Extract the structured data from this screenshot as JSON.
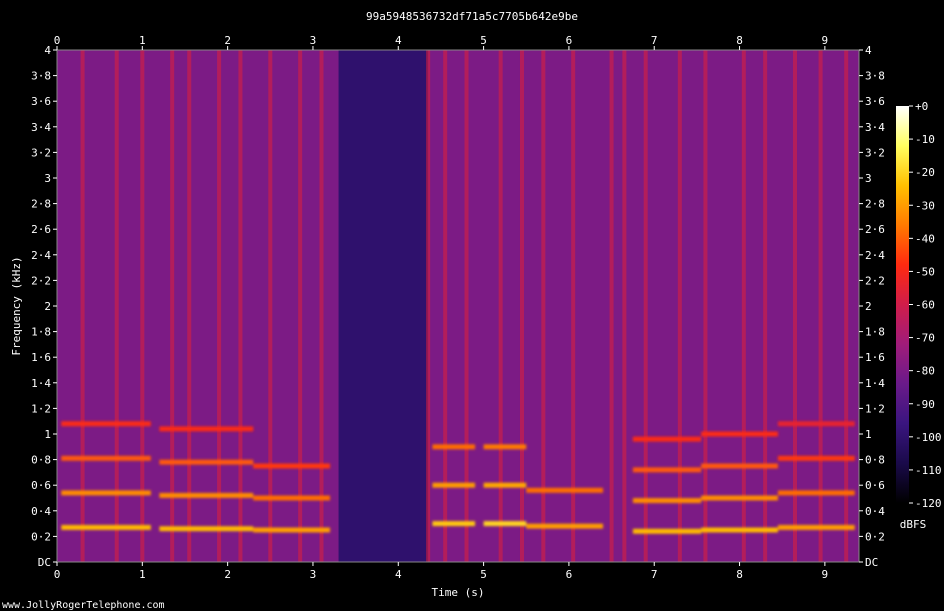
{
  "chart_data": {
    "type": "heatmap",
    "title": "99a5948536732df71a5c7705b642e9be",
    "xlabel": "Time (s)",
    "ylabel": "Frequency (kHz)",
    "xlim": [
      0,
      9.4
    ],
    "ylim": [
      0,
      4
    ],
    "x_ticks": [
      {
        "value": 0,
        "label": "0"
      },
      {
        "value": 1,
        "label": "1"
      },
      {
        "value": 2,
        "label": "2"
      },
      {
        "value": 3,
        "label": "3"
      },
      {
        "value": 4,
        "label": "4"
      },
      {
        "value": 5,
        "label": "5"
      },
      {
        "value": 6,
        "label": "6"
      },
      {
        "value": 7,
        "label": "7"
      },
      {
        "value": 8,
        "label": "8"
      },
      {
        "value": 9,
        "label": "9"
      }
    ],
    "y_ticks": [
      {
        "value": 0,
        "label": "DC"
      },
      {
        "value": 0.2,
        "label": "0·2"
      },
      {
        "value": 0.4,
        "label": "0·4"
      },
      {
        "value": 0.6,
        "label": "0·6"
      },
      {
        "value": 0.8,
        "label": "0·8"
      },
      {
        "value": 1.0,
        "label": "1"
      },
      {
        "value": 1.2,
        "label": "1·2"
      },
      {
        "value": 1.4,
        "label": "1·4"
      },
      {
        "value": 1.6,
        "label": "1·6"
      },
      {
        "value": 1.8,
        "label": "1·8"
      },
      {
        "value": 2.0,
        "label": "2"
      },
      {
        "value": 2.2,
        "label": "2·2"
      },
      {
        "value": 2.4,
        "label": "2·4"
      },
      {
        "value": 2.6,
        "label": "2·6"
      },
      {
        "value": 2.8,
        "label": "2·8"
      },
      {
        "value": 3.0,
        "label": "3"
      },
      {
        "value": 3.2,
        "label": "3·2"
      },
      {
        "value": 3.4,
        "label": "3·4"
      },
      {
        "value": 3.6,
        "label": "3·6"
      },
      {
        "value": 3.8,
        "label": "3·8"
      },
      {
        "value": 4.0,
        "label": "4"
      }
    ],
    "colorbar": {
      "unit": "dBFS",
      "range": [
        -120,
        0
      ],
      "ticks": [
        {
          "value": 0,
          "label": "+0"
        },
        {
          "value": -10,
          "label": "-10"
        },
        {
          "value": -20,
          "label": "-20"
        },
        {
          "value": -30,
          "label": "-30"
        },
        {
          "value": -40,
          "label": "-40"
        },
        {
          "value": -50,
          "label": "-50"
        },
        {
          "value": -60,
          "label": "-60"
        },
        {
          "value": -70,
          "label": "-70"
        },
        {
          "value": -80,
          "label": "-80"
        },
        {
          "value": -90,
          "label": "-90"
        },
        {
          "value": -100,
          "label": "-100"
        },
        {
          "value": -110,
          "label": "-110"
        },
        {
          "value": -120,
          "label": "-120"
        }
      ],
      "colors": [
        "#000000",
        "#1a0a4a",
        "#3a157f",
        "#6a1a8a",
        "#a01c7a",
        "#d01d4a",
        "#ff2a10",
        "#ff7a00",
        "#ffc000",
        "#ffff60",
        "#ffffff"
      ]
    },
    "background_db": -80,
    "quiet_segments": [
      {
        "t_start": 3.3,
        "t_end": 4.35,
        "db": -100
      }
    ],
    "harmonic_notes": [
      {
        "t_start": 0.05,
        "t_end": 1.1,
        "f0": 0.27,
        "harmonics": 4,
        "db": -25
      },
      {
        "t_start": 1.2,
        "t_end": 2.3,
        "f0": 0.26,
        "harmonics": 4,
        "db": -25
      },
      {
        "t_start": 2.3,
        "t_end": 3.2,
        "f0": 0.25,
        "harmonics": 3,
        "db": -30
      },
      {
        "t_start": 4.4,
        "t_end": 4.9,
        "f0": 0.3,
        "harmonics": 3,
        "db": -22
      },
      {
        "t_start": 5.0,
        "t_end": 5.5,
        "f0": 0.3,
        "harmonics": 3,
        "db": -20
      },
      {
        "t_start": 5.5,
        "t_end": 6.4,
        "f0": 0.28,
        "harmonics": 2,
        "db": -30
      },
      {
        "t_start": 6.75,
        "t_end": 7.55,
        "f0": 0.24,
        "harmonics": 4,
        "db": -25
      },
      {
        "t_start": 7.55,
        "t_end": 8.45,
        "f0": 0.25,
        "harmonics": 4,
        "db": -25
      },
      {
        "t_start": 8.45,
        "t_end": 9.35,
        "f0": 0.27,
        "harmonics": 4,
        "db": -30
      }
    ],
    "vertical_bursts": [
      0.3,
      0.7,
      1.0,
      1.35,
      1.55,
      1.9,
      2.15,
      2.5,
      2.85,
      3.1,
      4.35,
      4.55,
      4.8,
      5.2,
      5.45,
      5.7,
      6.05,
      6.5,
      6.65,
      6.9,
      7.3,
      7.6,
      8.05,
      8.3,
      8.65,
      8.95,
      9.25
    ]
  },
  "footer": {
    "credit": "www.JollyRogerTelephone.com"
  }
}
